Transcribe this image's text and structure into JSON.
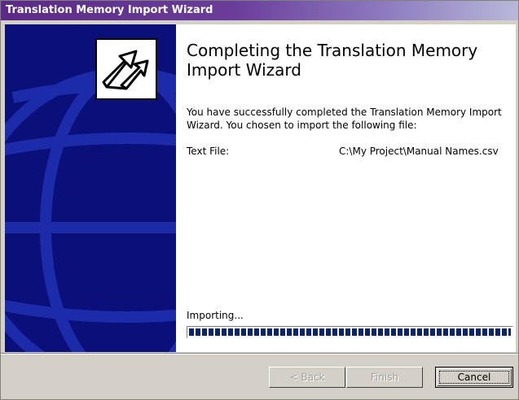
{
  "window": {
    "title": "Translation Memory Import Wizard"
  },
  "main": {
    "heading": "Completing the Translation Memory Import Wizard",
    "description": "You have successfully completed the Translation Memory Import Wizard. You chosen to import the following file:",
    "file_label": "Text File:",
    "file_path": "C:\\My Project\\Manual Names.csv",
    "status_label": "Importing...",
    "progress": 1.0
  },
  "buttons": {
    "back": "< Back",
    "finish": "Finish",
    "cancel": "Cancel"
  },
  "icons": {
    "sidebar": "globe-graphic",
    "logo": "import-arrows-icon"
  },
  "colors": {
    "sidebar_bg": "#0a0f7a",
    "progress_fill": "#0a246a",
    "title_bar": "#5b2a86"
  }
}
